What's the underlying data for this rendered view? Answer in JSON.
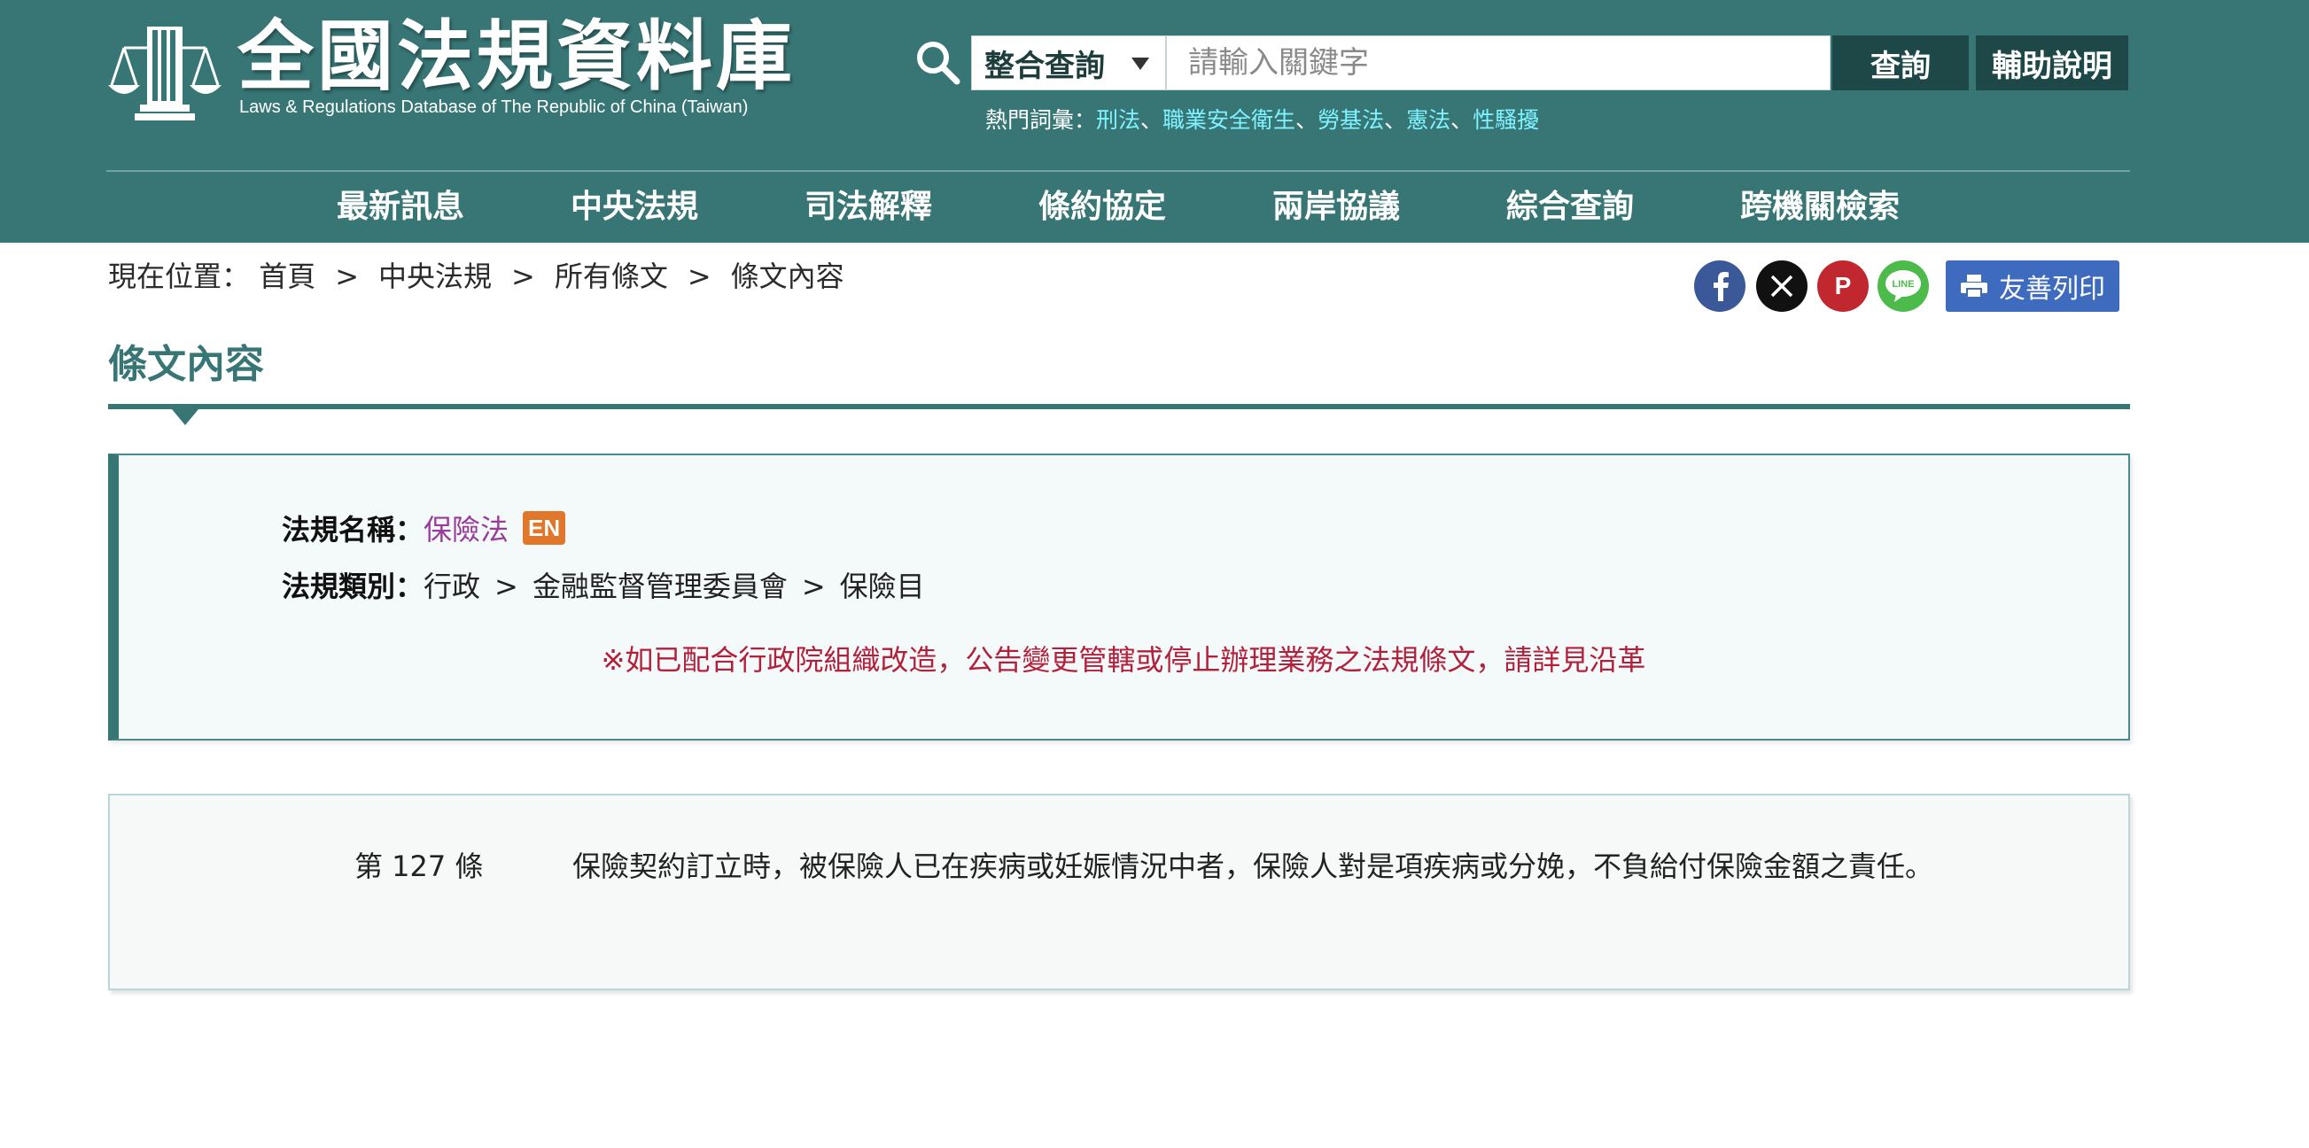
{
  "header": {
    "title": "全國法規資料庫",
    "subtitle": "Laws & Regulations Database of The Republic of China (Taiwan)",
    "search": {
      "scope": "整合查詢",
      "placeholder": "請輸入關鍵字",
      "query_label": "查詢",
      "help_label": "輔助說明"
    },
    "hot_terms": {
      "label": "熱門詞彙：",
      "separator": "、",
      "items": [
        "刑法",
        "職業安全衛生",
        "勞基法",
        "憲法",
        "性騷擾"
      ]
    },
    "nav": [
      "最新訊息",
      "中央法規",
      "司法解釋",
      "條約協定",
      "兩岸協議",
      "綜合查詢",
      "跨機關檢索"
    ]
  },
  "breadcrumb": {
    "label": "現在位置：",
    "separator": ">",
    "items": [
      "首頁",
      "中央法規",
      "所有條文",
      "條文內容"
    ]
  },
  "share": {
    "icons": [
      "facebook-icon",
      "x-icon",
      "plurk-icon",
      "line-icon"
    ],
    "line_text": "LINE",
    "plurk_text": "P",
    "print_label": "友善列印"
  },
  "page_title": "條文內容",
  "law_info": {
    "name_label": "法規名稱：",
    "name": "保險法",
    "en_badge": "EN",
    "category_label": "法規類別：",
    "category_separator": ">",
    "category": [
      "行政",
      "金融監督管理委員會",
      "保險目"
    ],
    "notice": "※如已配合行政院組織改造，公告變更管轄或停止辦理業務之法規條文，請詳見沿革"
  },
  "article": {
    "number": "第 127 條",
    "text": "保險契約訂立時，被保險人已在疾病或妊娠情況中者，保險人對是項疾病或分娩，不負給付保險金額之責任。"
  },
  "colors": {
    "header_bg": "#387676",
    "accent_dark": "#1e4848",
    "hot_link": "#7ff3ff",
    "law_name": "#9a3a9a",
    "en_badge": "#e0772b",
    "notice": "#b3203b",
    "print_button": "#3e6bbd"
  }
}
